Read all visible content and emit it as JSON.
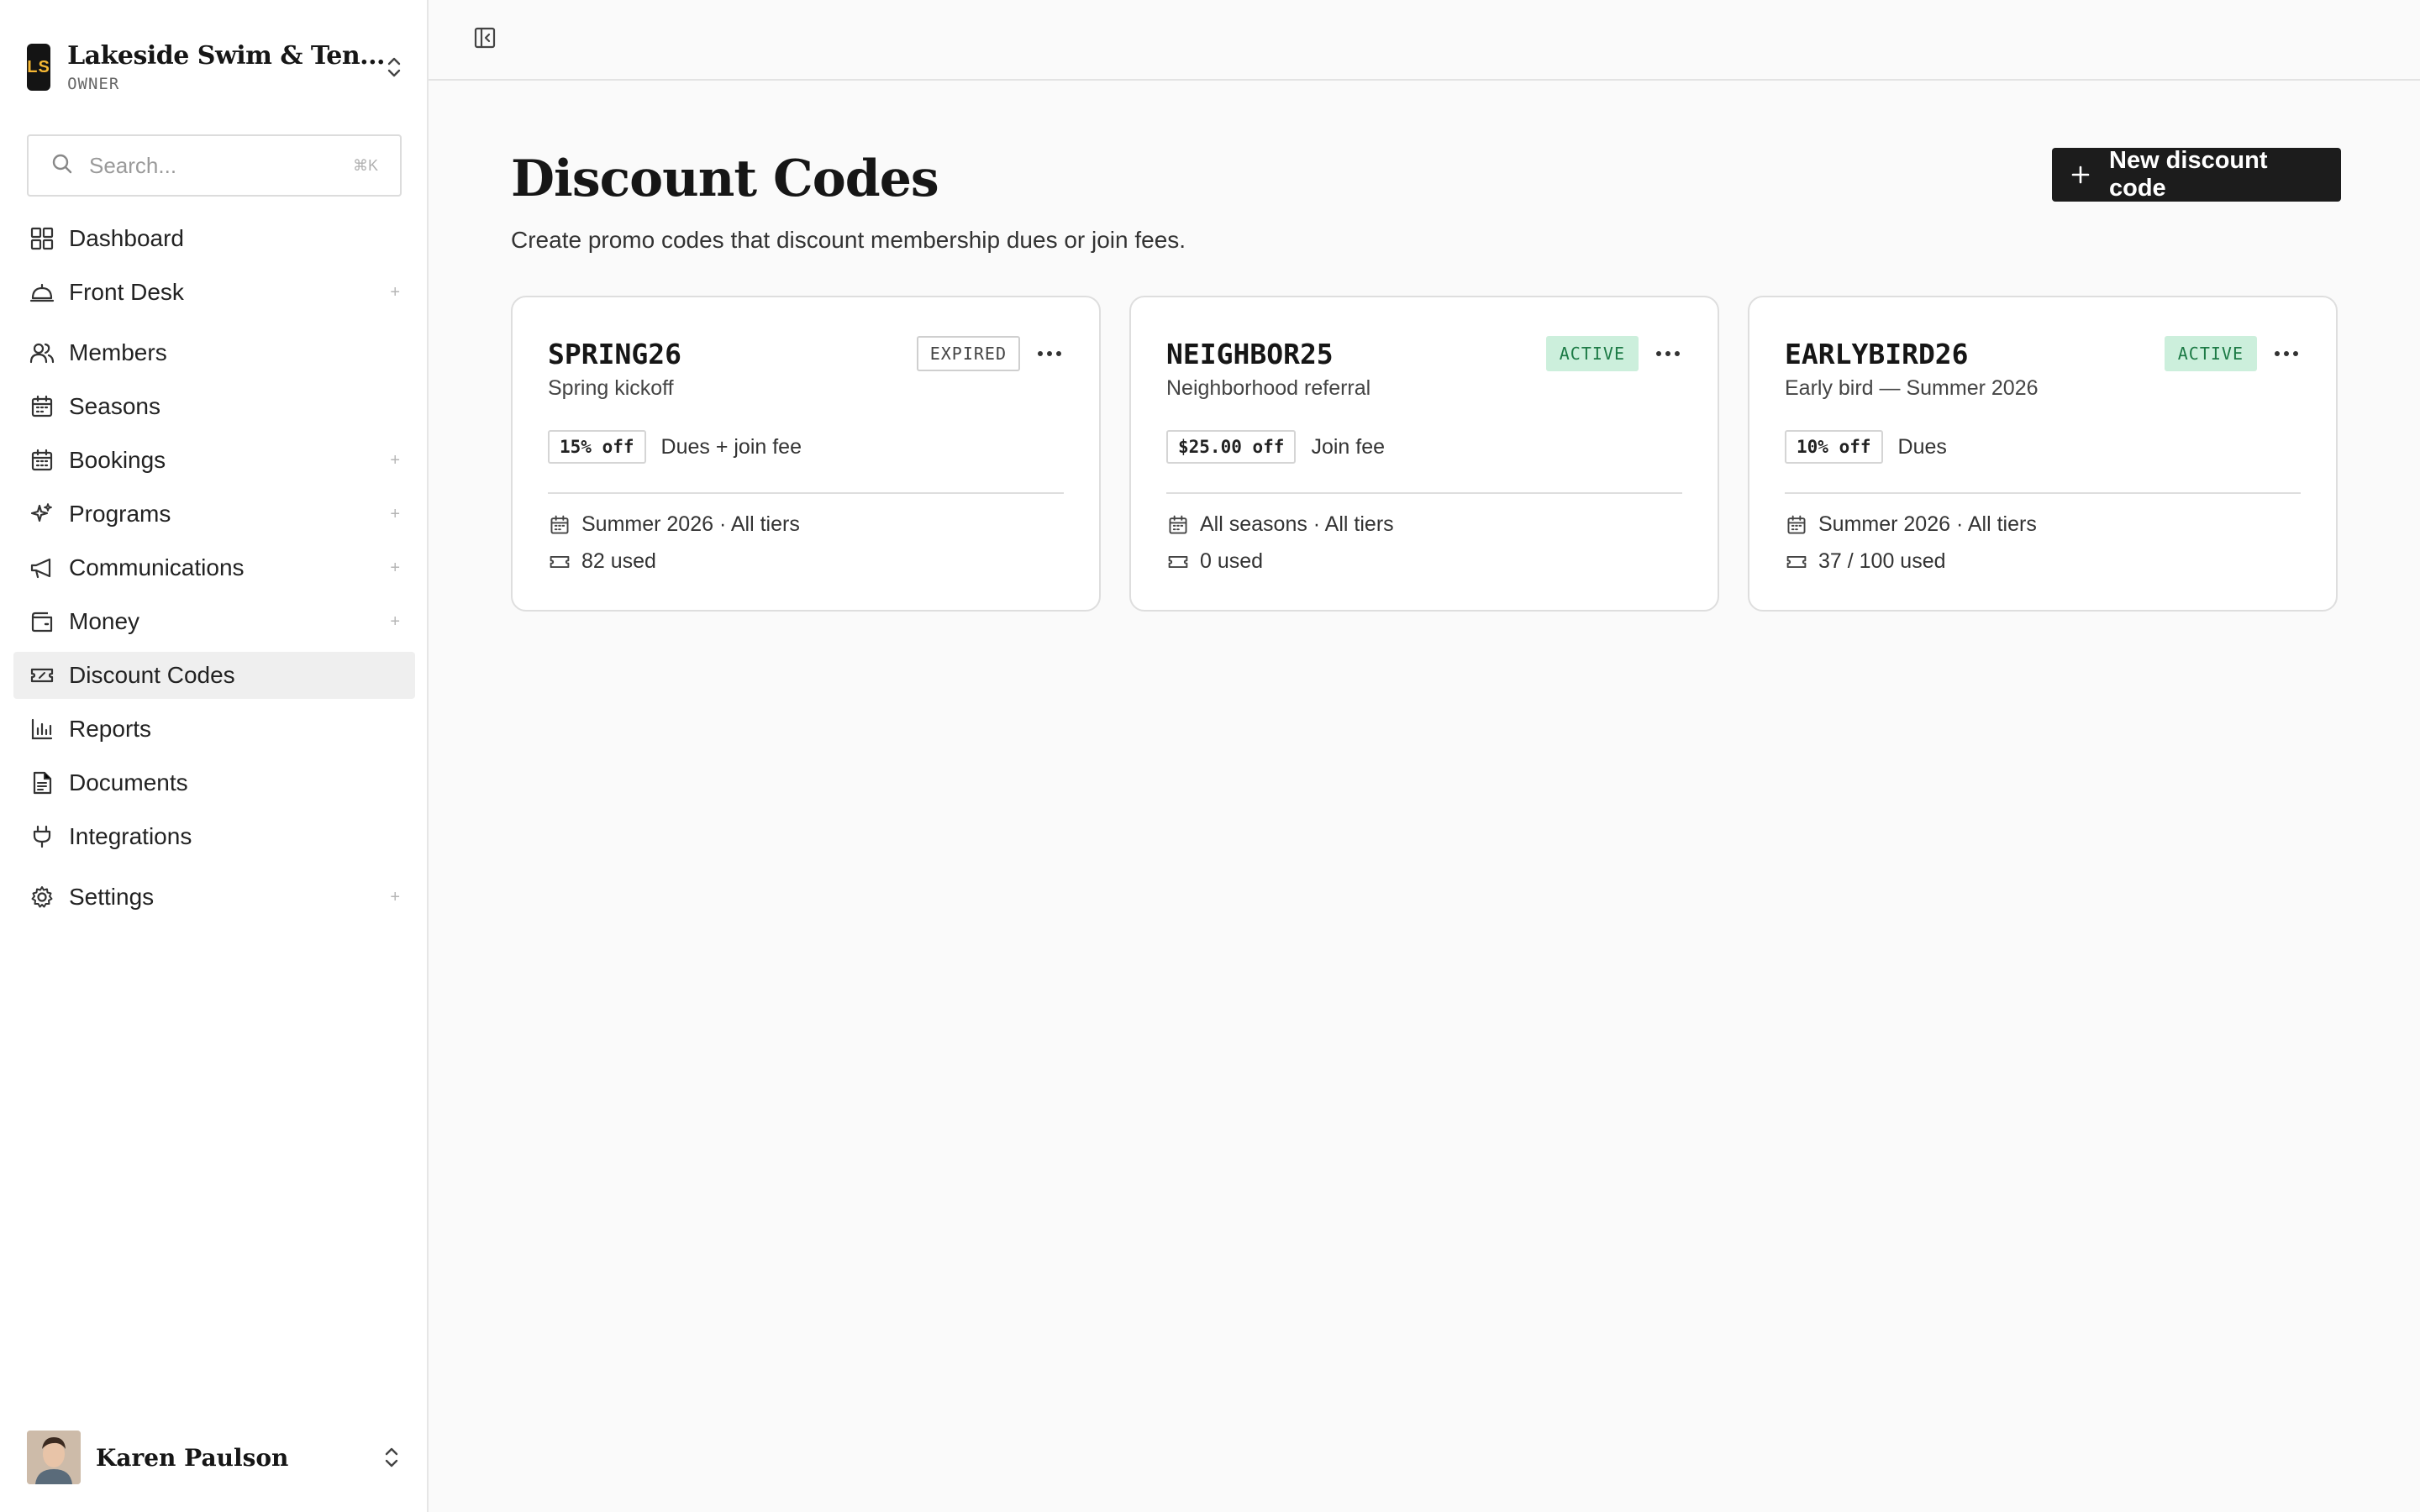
{
  "org": {
    "initials": "LS",
    "name": "Lakeside Swim & Ten...",
    "role": "OWNER"
  },
  "search": {
    "placeholder": "Search...",
    "shortcut": "⌘K"
  },
  "nav": [
    {
      "label": "Dashboard",
      "icon": "grid-icon",
      "plus": ""
    },
    {
      "label": "Front Desk",
      "icon": "bell-desk-icon",
      "plus": "+"
    },
    {
      "label": "Members",
      "icon": "users-icon",
      "plus": ""
    },
    {
      "label": "Seasons",
      "icon": "calendar-icon",
      "plus": ""
    },
    {
      "label": "Bookings",
      "icon": "calendar-check-icon",
      "plus": "+"
    },
    {
      "label": "Programs",
      "icon": "sparkles-icon",
      "plus": "+"
    },
    {
      "label": "Communications",
      "icon": "megaphone-icon",
      "plus": "+"
    },
    {
      "label": "Money",
      "icon": "wallet-icon",
      "plus": "+"
    },
    {
      "label": "Discount Codes",
      "icon": "ticket-icon",
      "plus": ""
    },
    {
      "label": "Reports",
      "icon": "bar-chart-icon",
      "plus": ""
    },
    {
      "label": "Documents",
      "icon": "document-icon",
      "plus": ""
    },
    {
      "label": "Integrations",
      "icon": "plug-icon",
      "plus": ""
    },
    {
      "label": "Settings",
      "icon": "gear-icon",
      "plus": "+"
    }
  ],
  "user": {
    "name": "Karen Paulson"
  },
  "page": {
    "title": "Discount Codes",
    "subtitle": "Create promo codes that discount membership dues or join fees.",
    "new_button": "New discount code"
  },
  "cards": [
    {
      "code": "SPRING26",
      "description": "Spring kickoff",
      "status": "EXPIRED",
      "off": "15% off",
      "applies": "Dues + join fee",
      "scope": "Summer 2026 · All tiers",
      "usage": "82 used"
    },
    {
      "code": "NEIGHBOR25",
      "description": "Neighborhood referral",
      "status": "ACTIVE",
      "off": "$25.00 off",
      "applies": "Join fee",
      "scope": "All seasons · All tiers",
      "usage": "0 used"
    },
    {
      "code": "EARLYBIRD26",
      "description": "Early bird — Summer 2026",
      "status": "ACTIVE",
      "off": "10% off",
      "applies": "Dues",
      "scope": "Summer 2026 · All tiers",
      "usage": "37 / 100 used"
    }
  ],
  "colors": {
    "accent": "#1c1c1c",
    "active_bg": "#ccefdc",
    "active_text": "#1c7a45",
    "logo_text": "#f5b733"
  }
}
